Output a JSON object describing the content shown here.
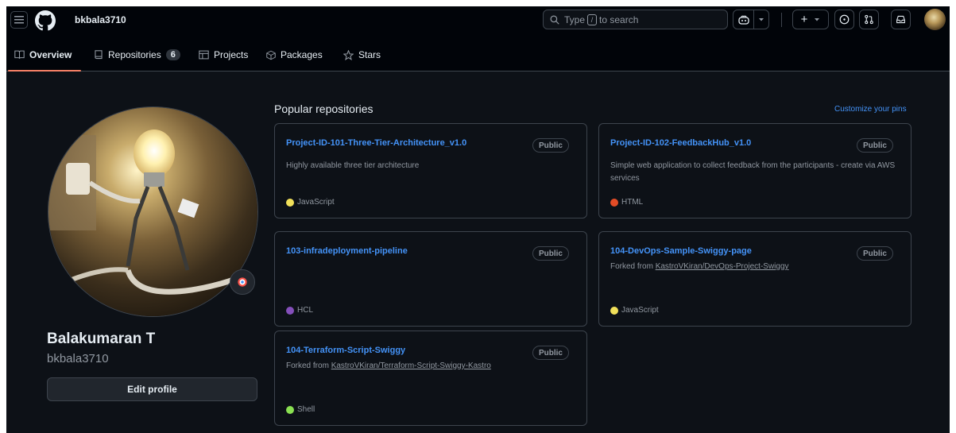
{
  "header": {
    "username": "bkbala3710",
    "search_prefix": "Type",
    "search_key": "/",
    "search_suffix": "to search",
    "plus_label": "+"
  },
  "tabs": [
    {
      "label": "Overview",
      "icon": "book-icon",
      "active": true
    },
    {
      "label": "Repositories",
      "icon": "repo-icon",
      "count": "6"
    },
    {
      "label": "Projects",
      "icon": "table-icon"
    },
    {
      "label": "Packages",
      "icon": "package-icon"
    },
    {
      "label": "Stars",
      "icon": "star-icon"
    }
  ],
  "profile": {
    "full_name": "Balakumaran T",
    "login": "bkbala3710",
    "edit_label": "Edit profile"
  },
  "pinned": {
    "title": "Popular repositories",
    "customize_label": "Customize your pins",
    "repos": [
      {
        "name": "Project-ID-101-Three-Tier-Architecture_v1.0",
        "visibility": "Public",
        "description": "Highly available three tier architecture",
        "language": "JavaScript",
        "lang_color": "#f1e05a"
      },
      {
        "name": "Project-ID-102-FeedbackHub_v1.0",
        "visibility": "Public",
        "description": "Simple web application to collect feedback from the participants - create via AWS services",
        "language": "HTML",
        "lang_color": "#e34c26"
      },
      {
        "name": "103-infradeployment-pipeline",
        "visibility": "Public",
        "description": "",
        "language": "HCL",
        "lang_color": "#844fba"
      },
      {
        "name": "104-DevOps-Sample-Swiggy-page",
        "visibility": "Public",
        "forked_prefix": "Forked from",
        "forked_from": "KastroVKiran/DevOps-Project-Swiggy",
        "language": "JavaScript",
        "lang_color": "#f1e05a"
      },
      {
        "name": "104-Terraform-Script-Swiggy",
        "visibility": "Public",
        "forked_prefix": "Forked from",
        "forked_from": "KastroVKiran/Terraform-Script-Swiggy-Kastro",
        "language": "Shell",
        "lang_color": "#89e051"
      }
    ]
  }
}
